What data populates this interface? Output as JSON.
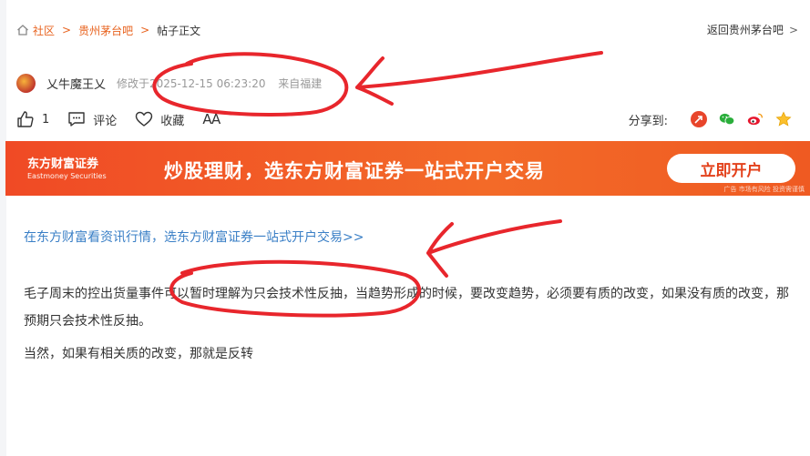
{
  "breadcrumb": {
    "items": [
      "社区",
      "贵州茅台吧"
    ],
    "current": "帖子正文"
  },
  "back_link": {
    "label": "返回贵州茅台吧",
    "chevron": ">"
  },
  "author": {
    "name": "乂牛魔王乂",
    "modified_label": "修改于2025-12-15 06:23:20",
    "location": "来自福建"
  },
  "actions": {
    "like_count": "1",
    "comment_label": "评论",
    "favorite_label": "收藏",
    "font_size_label": "AA"
  },
  "share": {
    "label": "分享到:",
    "icons": [
      "tencent-weibo-icon",
      "wechat-icon",
      "sina-weibo-icon",
      "qzone-icon"
    ]
  },
  "banner": {
    "logo_cn": "东方财富证券",
    "logo_en": "Eastmoney Securities",
    "slogan": "炒股理财，选东方财富证券一站式开户交易",
    "cta": "立即开户",
    "risk_note": "广告 市场有风险 投资需谨慎"
  },
  "promo_link": "在东方财富看资讯行情，选东方财富证券一站式开户交易>>",
  "post": {
    "paragraphs": [
      "毛子周末的控出货量事件可以暂时理解为只会技术性反抽，当趋势形成的时候，要改变趋势，必须要有质的改变，如果没有质的改变，那预期只会技术性反抽。",
      "当然，如果有相关质的改变，那就是反转"
    ]
  },
  "colors": {
    "accent": "#e8631f",
    "link": "#3a7fc6",
    "banner": "#f04a25",
    "annotation": "#e8262c"
  }
}
